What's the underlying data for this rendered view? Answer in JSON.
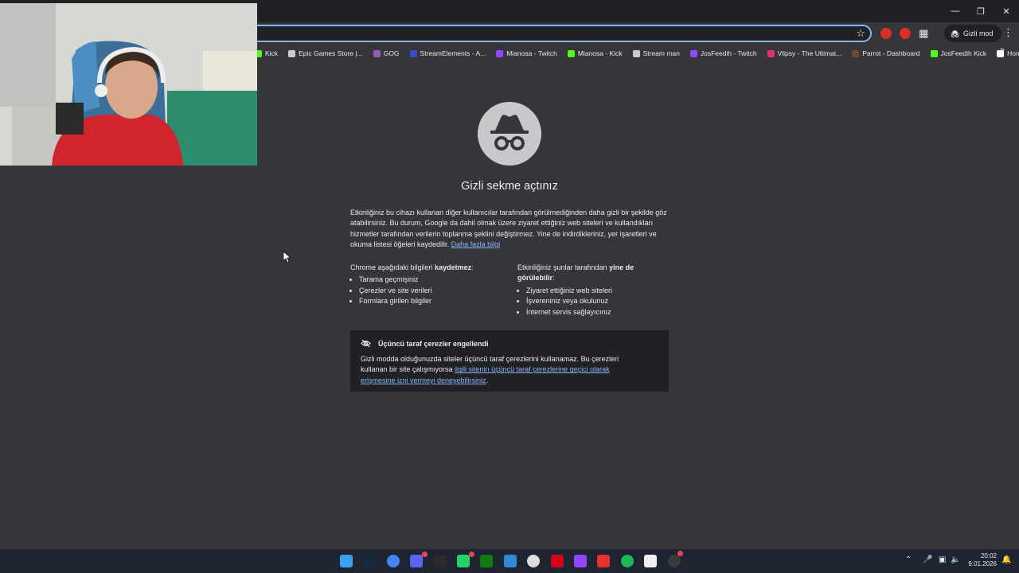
{
  "browser": {
    "incognito_label": "Gizli mod",
    "bookmarks": [
      {
        "label": "Kick",
        "color": "#53fc18"
      },
      {
        "label": "Epic Games Store |...",
        "color": "#cccccc"
      },
      {
        "label": "GOG",
        "color": "#9b59b6"
      },
      {
        "label": "StreamElements - A...",
        "color": "#3b4cca"
      },
      {
        "label": "Mianosa - Twitch",
        "color": "#9146ff"
      },
      {
        "label": "Mianosa - Kick",
        "color": "#53fc18"
      },
      {
        "label": "Stream man",
        "color": "#cccccc"
      },
      {
        "label": "JosFeedih - Twitch",
        "color": "#9146ff"
      },
      {
        "label": "Vlipsy - The Ultimat...",
        "color": "#e5316b"
      },
      {
        "label": "Parrot - Dashboard",
        "color": "#6b4b2a"
      },
      {
        "label": "JosFeedih Kick",
        "color": "#53fc18"
      },
      {
        "label": "Home",
        "color": "#ffffff"
      }
    ]
  },
  "page": {
    "title": "Gizli sekme açtınız",
    "intro_text": "Etkinliğiniz bu cihazı kullanan diğer kullanıcılar tarafından görülmediğinden daha gizli bir şekilde göz atabilirsiniz. Bu durum, Google da dahil olmak üzere ziyaret ettiğiniz web siteleri ve kullandıkları hizmetler tarafından verilerin toplanma şeklini değiştirmez. Yine de indirdikleriniz, yer işaretleri ve okuma listesi öğeleri kaydedilir.",
    "learn_more": "Daha fazla bilgi",
    "left_col": {
      "heading_prefix": "Chrome aşağıdaki bilgileri ",
      "heading_bold": "kaydetmez",
      "heading_suffix": ":",
      "items": [
        "Tarama geçmişiniz",
        "Çerezler ve site verileri",
        "Formlara girilen bilgiler"
      ]
    },
    "right_col": {
      "heading_prefix": "Etkinliğiniz şunlar tarafından ",
      "heading_bold": "yine de görülebilir",
      "heading_suffix": ":",
      "items": [
        "Ziyaret ettiğiniz web siteleri",
        "İşvereniniz veya okulunuz",
        "İnternet servis sağlayıcınız"
      ]
    },
    "cookie_title": "Üçüncü taraf çerezler engellendi",
    "cookie_text": "Gizli modda olduğunuzda siteler üçüncü taraf çerezlerini kullanamaz. Bu çerezleri kullanan bir site çalışmıyorsa ",
    "cookie_link": "ilgili sitenin üçüncü taraf çerezlerine geçici olarak erişmesine izni vermeyi deneyebilirsiniz",
    "cookie_end": "."
  },
  "taskbar": {
    "apps": [
      "windows-start",
      "steam",
      "chrome",
      "discord",
      "epic-games",
      "whatsapp",
      "xbox",
      "photos",
      "steelseries",
      "red-app",
      "twitch",
      "app-red-2",
      "spotify",
      "capcut",
      "obs"
    ],
    "time": "20:02",
    "date": "9.01.2026"
  }
}
